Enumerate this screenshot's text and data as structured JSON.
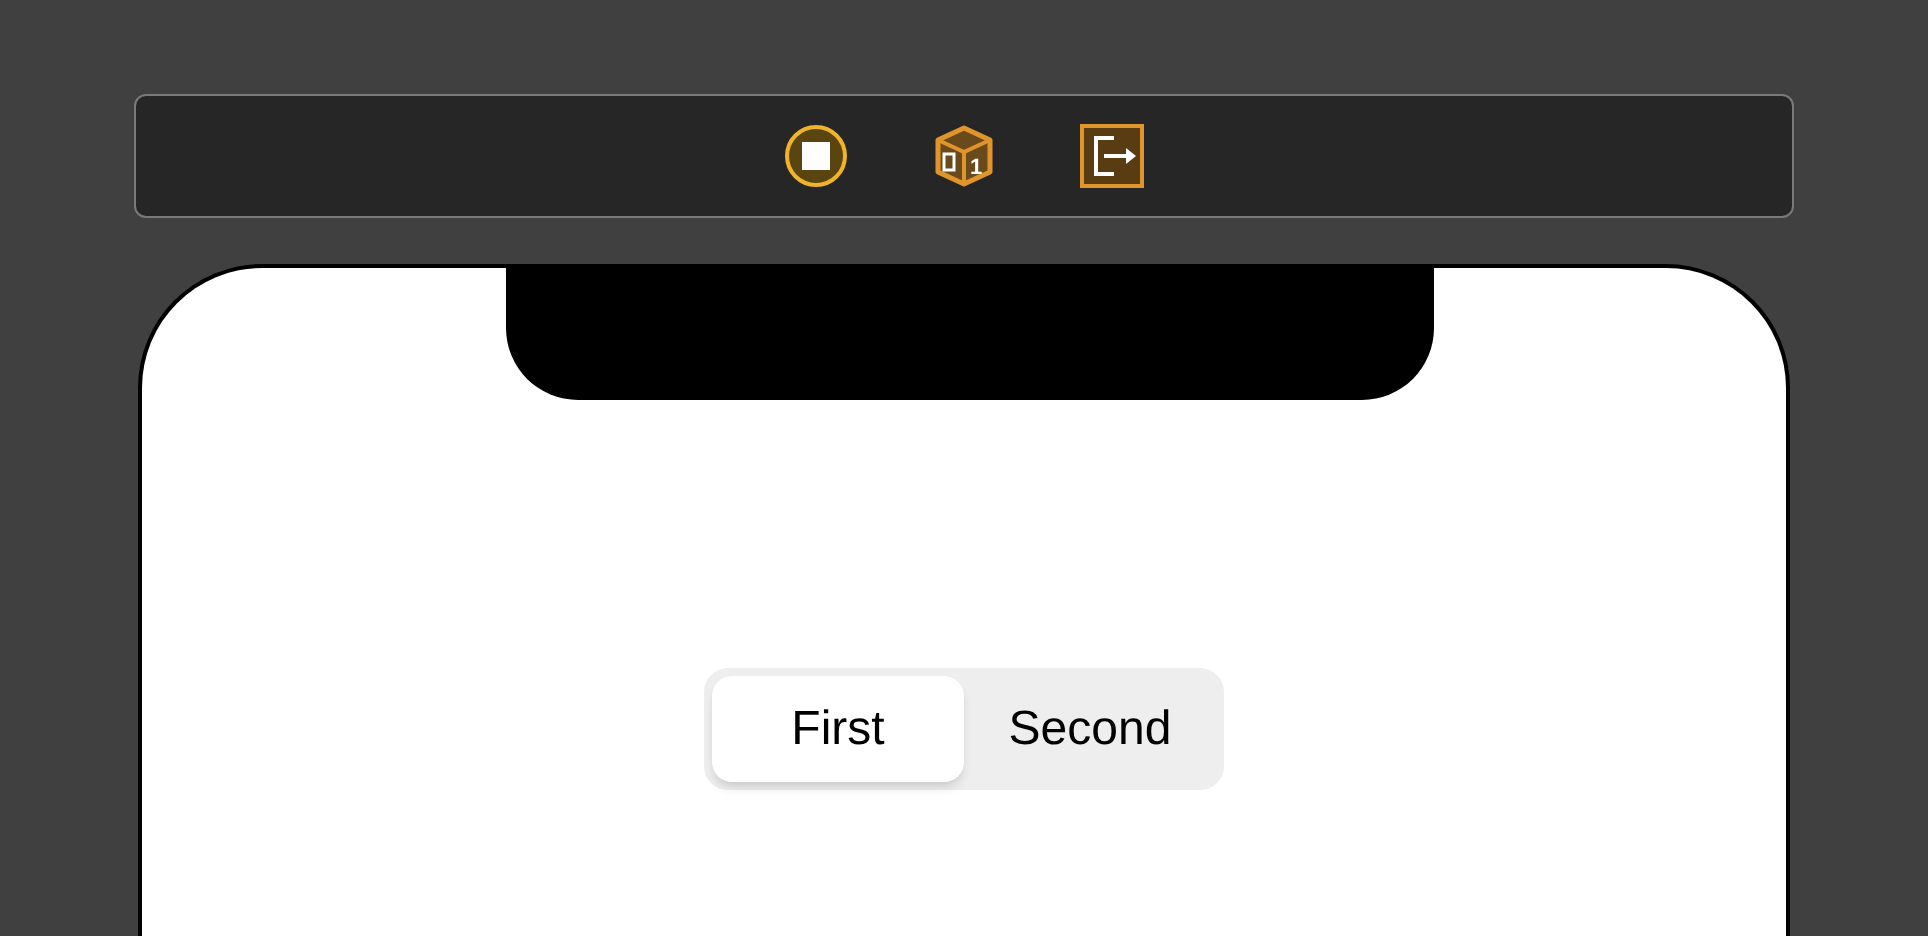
{
  "toolbar": {
    "cube_badge": "1"
  },
  "segmented_control": {
    "segments": [
      {
        "label": "First",
        "selected": true
      },
      {
        "label": "Second",
        "selected": false
      }
    ]
  }
}
